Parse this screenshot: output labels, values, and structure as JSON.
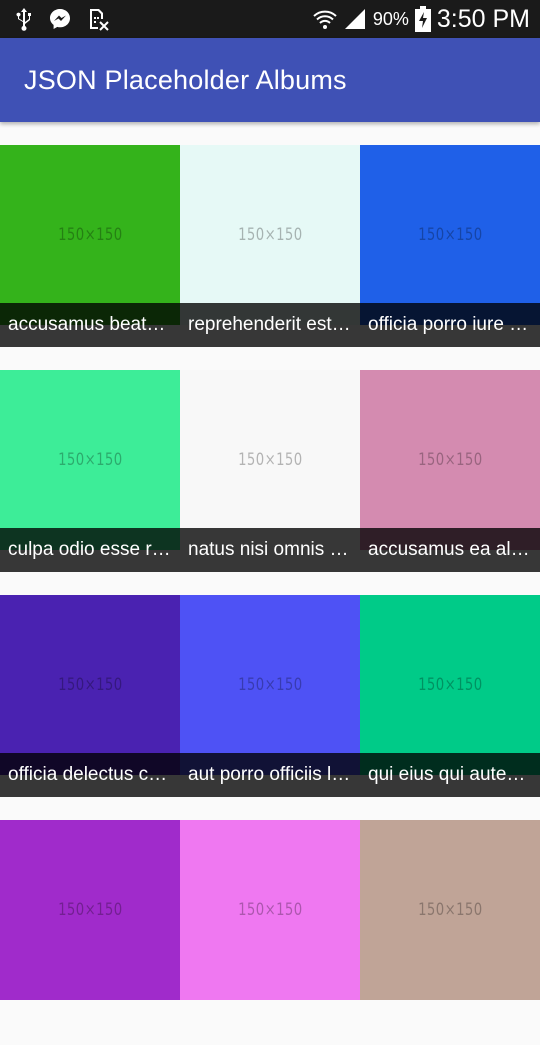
{
  "status_bar": {
    "battery": "90%",
    "time": "3:50 PM",
    "icons_left": [
      "usb-icon",
      "messenger-icon",
      "sim-card-off-icon"
    ],
    "icons_right": [
      "wifi-icon",
      "cell-signal-icon",
      "battery-charging-icon"
    ]
  },
  "app_bar": {
    "title": "JSON Placeholder Albums",
    "color": "#3f51b5"
  },
  "albums": [
    {
      "title": "accusamus beatae ad facilis cum similique qui sunt",
      "thumb_label": "150×150",
      "color": "#34b31b"
    },
    {
      "title": "reprehenderit est deserunt velit ipsam",
      "thumb_label": "150×150",
      "color": "#e6f9f6"
    },
    {
      "title": "officia porro iure quia iusto qui ipsa ut modi",
      "thumb_label": "150×150",
      "color": "#1f60e8"
    },
    {
      "title": "culpa odio esse rerum omnis laboriosam voluptate repudiandae",
      "thumb_label": "150×150",
      "color": "#3ded98"
    },
    {
      "title": "natus nisi omnis corporis facere molestiae rerum in",
      "thumb_label": "150×150",
      "color": "#f8f8f8"
    },
    {
      "title": "accusamus ea aliquid et amet sequi nemo",
      "thumb_label": "150×150",
      "color": "#d48bb0"
    },
    {
      "title": "officia delectus consequatur vero aut veniam explicabo molestias",
      "thumb_label": "150×150",
      "color": "#4a22b1"
    },
    {
      "title": "aut porro officiis laborum odit ea laudantium corporis",
      "thumb_label": "150×150",
      "color": "#4e52f5"
    },
    {
      "title": "qui eius qui autem sed",
      "thumb_label": "150×150",
      "color": "#00cb88"
    },
    {
      "title": "",
      "thumb_label": "150×150",
      "color": "#a02bcb"
    },
    {
      "title": "",
      "thumb_label": "150×150",
      "color": "#ef78f1"
    },
    {
      "title": "",
      "thumb_label": "150×150",
      "color": "#c0a497"
    }
  ]
}
